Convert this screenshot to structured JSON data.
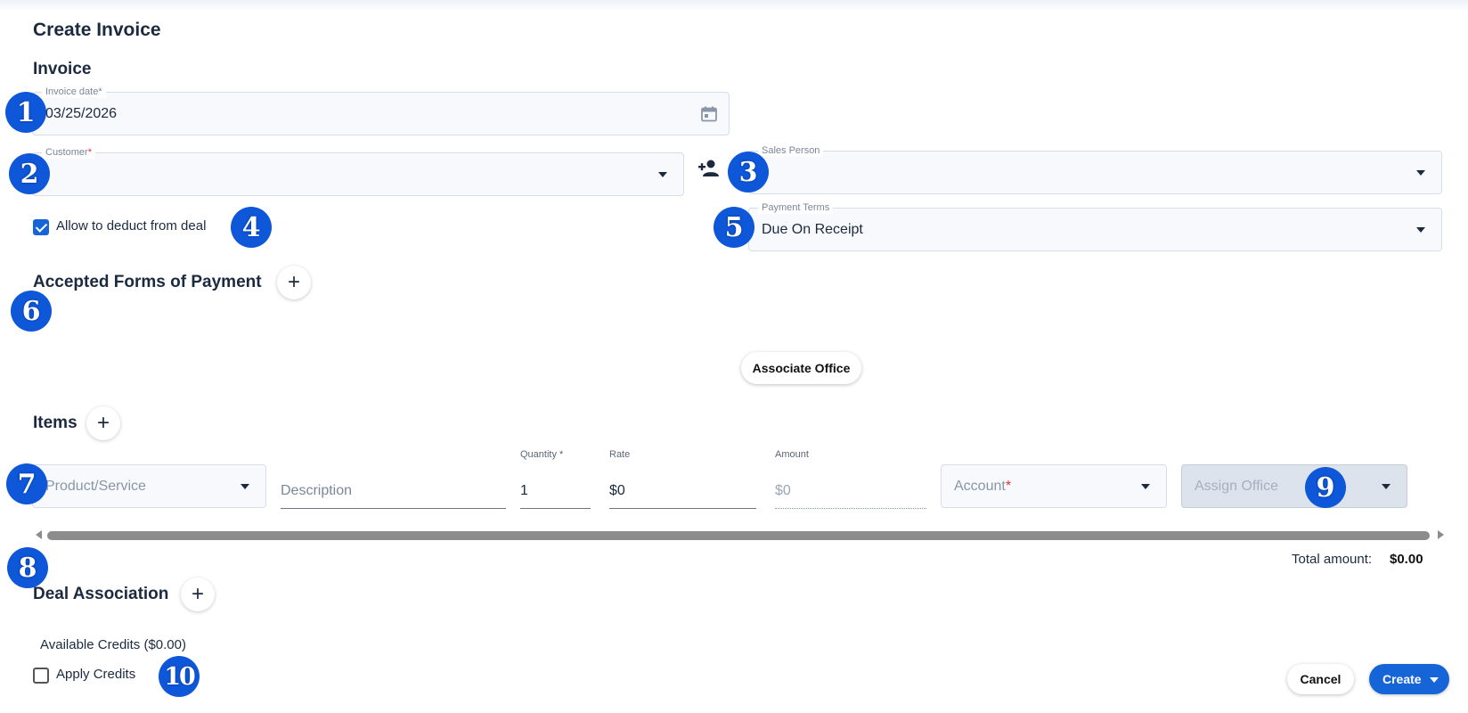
{
  "page": {
    "title": "Create Invoice",
    "section_title": "Invoice"
  },
  "invoice_date": {
    "label": "Invoice date",
    "required_mark": "*",
    "value": "03/25/2026"
  },
  "customer": {
    "label": "Customer",
    "required_mark": "*",
    "value": ""
  },
  "sales_person": {
    "label": "Sales Person",
    "value": ""
  },
  "allow_deduct": {
    "label": "Allow to deduct from deal",
    "checked": true
  },
  "payment_terms": {
    "label": "Payment Terms",
    "value": "Due On Receipt"
  },
  "accepted_forms": {
    "title": "Accepted Forms of Payment",
    "add_symbol": "+"
  },
  "associate_office": {
    "label": "Associate Office"
  },
  "items": {
    "title": "Items",
    "add_symbol": "+",
    "row": {
      "product_placeholder": "Product/Service",
      "description_placeholder": "Description",
      "quantity_label": "Quantity *",
      "quantity_value": "1",
      "rate_label": "Rate",
      "rate_value": "$0",
      "amount_label": "Amount",
      "amount_value": "$0",
      "account_placeholder": "Account",
      "account_required_mark": "*",
      "assign_office_placeholder": "Assign Office"
    }
  },
  "total": {
    "label": "Total amount:",
    "value": "$0.00"
  },
  "deal_association": {
    "title": "Deal Association",
    "add_symbol": "+"
  },
  "credits": {
    "available_text": "Available Credits ($0.00)",
    "apply_label": "Apply Credits",
    "apply_checked": false
  },
  "footer": {
    "cancel_label": "Cancel",
    "create_label": "Create"
  },
  "callouts": [
    "1",
    "2",
    "3",
    "4",
    "5",
    "6",
    "7",
    "8",
    "9",
    "10"
  ],
  "colors": {
    "primary": "#1565d8",
    "badge": "#0d57d8",
    "text": "#1c2a3f",
    "required": "#e0303a"
  },
  "icons": {
    "calendar": "calendar-icon",
    "add_person": "person-add-icon",
    "dropdown": "chevron-down-icon",
    "plus": "plus-icon"
  }
}
